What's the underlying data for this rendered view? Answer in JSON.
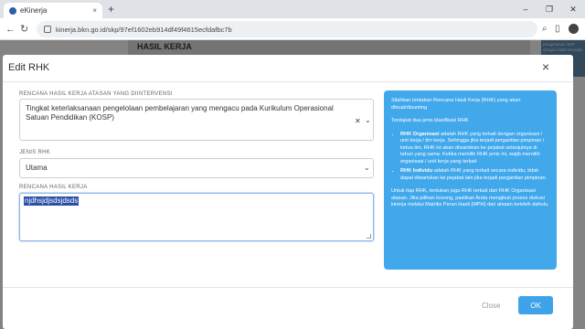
{
  "browser": {
    "tab_title": "eKinerja",
    "tab_close": "×",
    "new_tab": "+",
    "url": "kinerja.bkn.go.id/skp/97ef1602eb914df49f4615ecfdafbc7b",
    "window_controls": [
      "–",
      "❐",
      "✕"
    ]
  },
  "page": {
    "heading": "HASIL KERJA",
    "side_note": "pengesahan SKP dengan tidak tersedia"
  },
  "modal": {
    "title": "Edit RHK",
    "close": "×",
    "fields": {
      "atasan_label": "RENCANA HASIL KERJA ATASAN YANG DIINTERVENSI",
      "atasan_value": "Tingkat keterlaksanaan pengelolaan pembelajaran yang mengacu pada Kurikulum Operasional Satuan Pendidikan (KOSP)",
      "jenis_label": "JENIS RHK",
      "jenis_value": "Utama",
      "rhk_label": "RENCANA HASIL KERJA",
      "rhk_value": "njdhsjdjsdsjdsds"
    },
    "info": {
      "intro": "Silahkan tentukan Rencana Hasil Kerja (RHK) yang akan dibuat/disunting",
      "types_intro": "Terdapat dua jenis klasifikasi RHK",
      "item1_title": "RHK Organisasi",
      "item1_text": "adalah RHK yang terkait dengan organisasi / unit kerja / tim kerja. Sehingga jika terjadi pergantian pimpinan / ketua tim, RHK ini akan diwariskan ke pejabat selanjutnya di tahun yang sama. Ketika memilih RHK jenis ini, wajib memilih organisasi / unit kerja yang terkait",
      "item2_title": "RHK Individu",
      "item2_text": "adalah RHK yang terkait secara individu, tidak dapat diwariskan ke pejabat lain jika terjadi pergantian pimpinan.",
      "footer": "Untuk tiap RHK, tentukan juga RHK terkait dari RHK Organisasi atasan. Jika pilihan kosong, pastikan Anda mengikuti proses diskusi kinerja melalui Matriks Peran Hasil (MPH) dari atasan terlebih dahulu."
    },
    "buttons": {
      "close": "Close",
      "ok": "OK"
    }
  },
  "colors": {
    "accent": "#3ea3e8",
    "info_panel": "#41a8ec",
    "selection": "#2a4fa8"
  }
}
